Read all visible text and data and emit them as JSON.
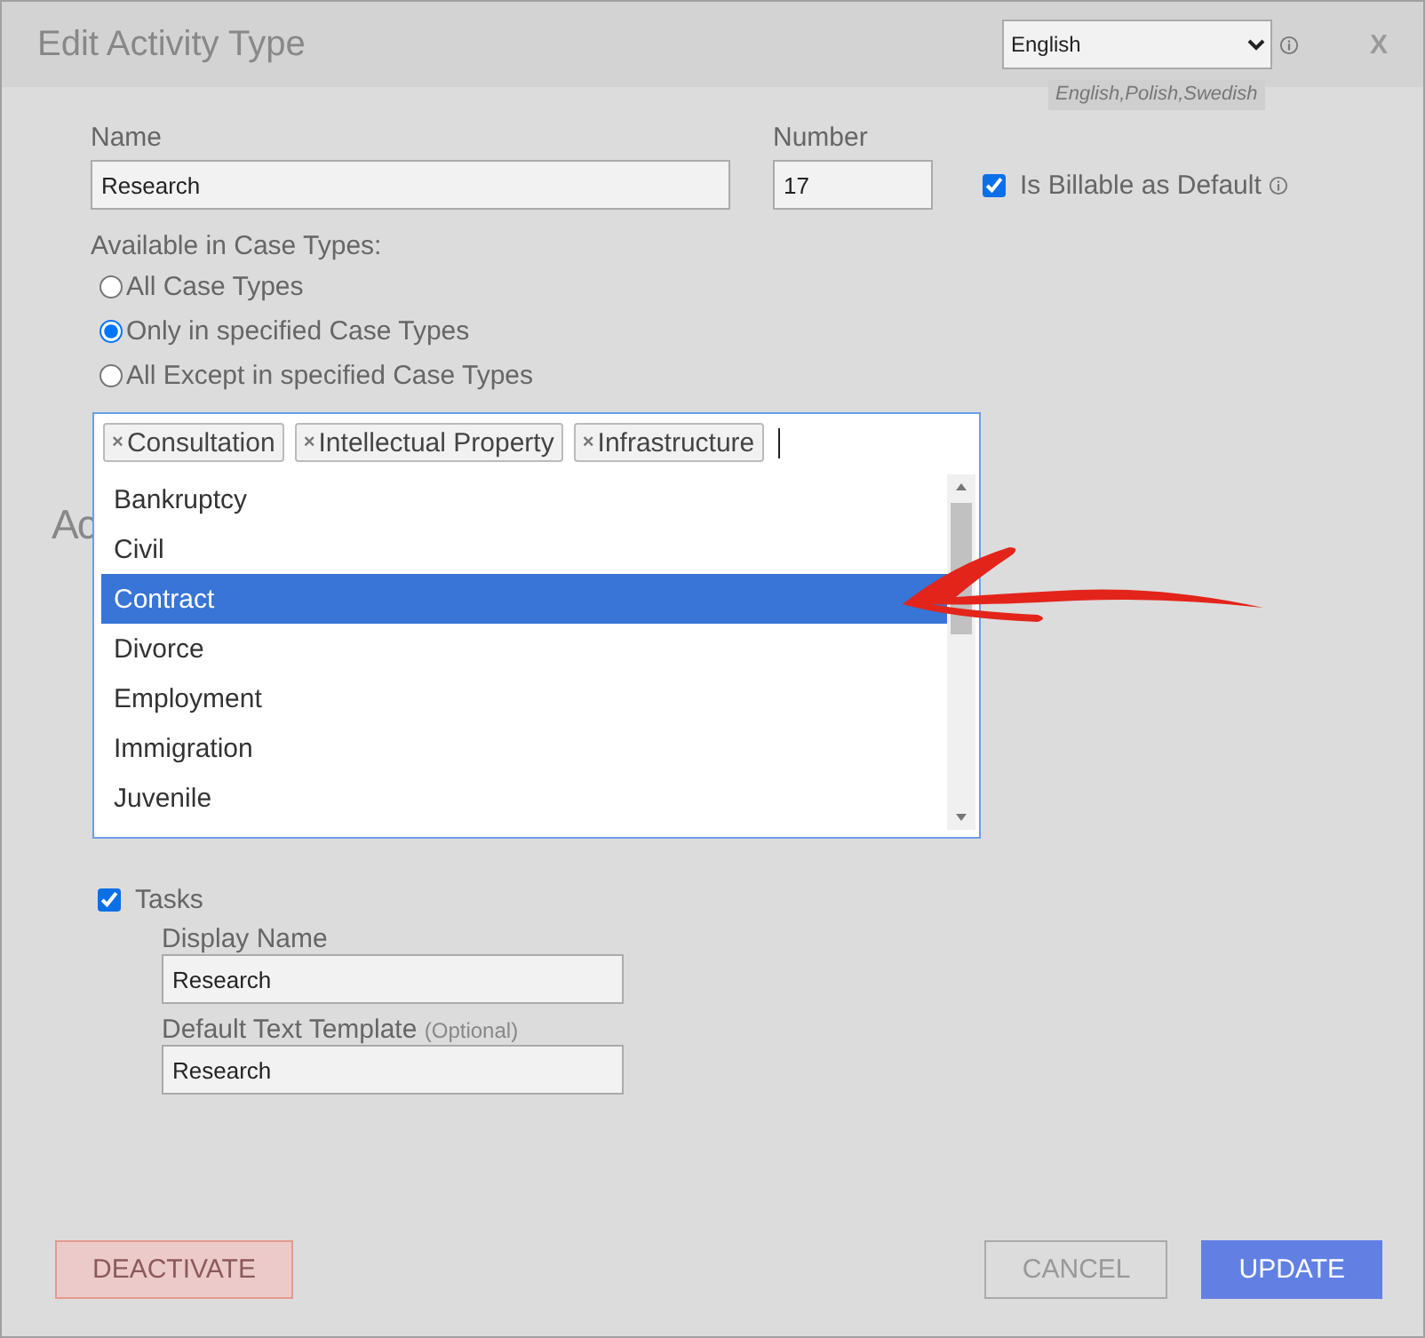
{
  "window": {
    "title": "Edit Activity Type",
    "close": "X"
  },
  "language": {
    "value": "English",
    "available": "English,Polish,Swedish"
  },
  "form": {
    "name": {
      "label": "Name",
      "value": "Research"
    },
    "number": {
      "label": "Number",
      "value": "17"
    },
    "billable": {
      "label": "Is Billable as Default",
      "checked": true
    }
  },
  "case_types": {
    "label": "Available in Case Types:",
    "options": [
      {
        "label": "All Case Types",
        "selected": false
      },
      {
        "label": "Only in specified Case Types",
        "selected": true
      },
      {
        "label": "All Except in specified Case Types",
        "selected": false
      }
    ],
    "tags": [
      {
        "label": "Consultation",
        "remove": "×"
      },
      {
        "label": "Intellectual Property",
        "remove": "×"
      },
      {
        "label": "Infrastructure",
        "remove": "×"
      }
    ],
    "list": [
      {
        "label": "Bankruptcy",
        "selected": false
      },
      {
        "label": "Civil",
        "selected": false
      },
      {
        "label": "Contract",
        "selected": true
      },
      {
        "label": "Divorce",
        "selected": false
      },
      {
        "label": "Employment",
        "selected": false
      },
      {
        "label": "Immigration",
        "selected": false
      },
      {
        "label": "Juvenile",
        "selected": false
      }
    ]
  },
  "section_heading": "Ac",
  "tasks": {
    "label": "Tasks",
    "checked": true,
    "display_name": {
      "label": "Display Name",
      "value": "Research"
    },
    "template": {
      "label": "Default Text Template",
      "optional": "(Optional)",
      "value": "Research"
    }
  },
  "buttons": [
    {
      "kind": "danger",
      "label": "DEACTIVATE"
    },
    {
      "kind": "secondary",
      "label": "CANCEL"
    },
    {
      "kind": "primary",
      "label": "UPDATE"
    }
  ]
}
